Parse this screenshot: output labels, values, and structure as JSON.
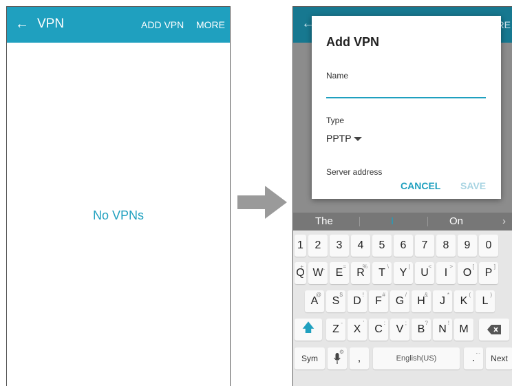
{
  "left": {
    "back_icon": "arrow-left-icon",
    "title": "VPN",
    "add_vpn": "ADD VPN",
    "more": "MORE",
    "empty_text": "No VPNs"
  },
  "right": {
    "more_partial": "RE",
    "dialog": {
      "title": "Add VPN",
      "name_label": "Name",
      "name_value": "",
      "type_label": "Type",
      "type_value": "PPTP",
      "server_label": "Server address",
      "cancel": "CANCEL",
      "save": "SAVE"
    },
    "keyboard": {
      "suggestions": [
        "The",
        "I",
        "On"
      ],
      "numbers": [
        "1",
        "2",
        "3",
        "4",
        "5",
        "6",
        "7",
        "8",
        "9",
        "0"
      ],
      "row1": [
        "Q",
        "W",
        "E",
        "R",
        "T",
        "Y",
        "U",
        "I",
        "O",
        "P"
      ],
      "row1_hints": [
        "+",
        "_",
        "=",
        "%",
        "\\",
        "|",
        "<",
        ">",
        "[",
        "]"
      ],
      "row2": [
        "A",
        "S",
        "D",
        "F",
        "G",
        "H",
        "J",
        "K",
        "L"
      ],
      "row2_hints": [
        "@",
        "$",
        "!",
        "#",
        "/",
        "&",
        "*",
        "(",
        ")"
      ],
      "row3": [
        "Z",
        "X",
        "C",
        "V",
        "B",
        "N",
        "M"
      ],
      "row3_hints": [
        "-",
        "'",
        ":",
        ";",
        "?",
        "!",
        ""
      ],
      "sym": "Sym",
      "comma": ",",
      "space": "English(US)",
      "period": ".",
      "next": "Next",
      "mic_hint": "⚙",
      "period_hint": "...",
      "colors": {
        "accent": "#1fa0bf"
      }
    }
  }
}
